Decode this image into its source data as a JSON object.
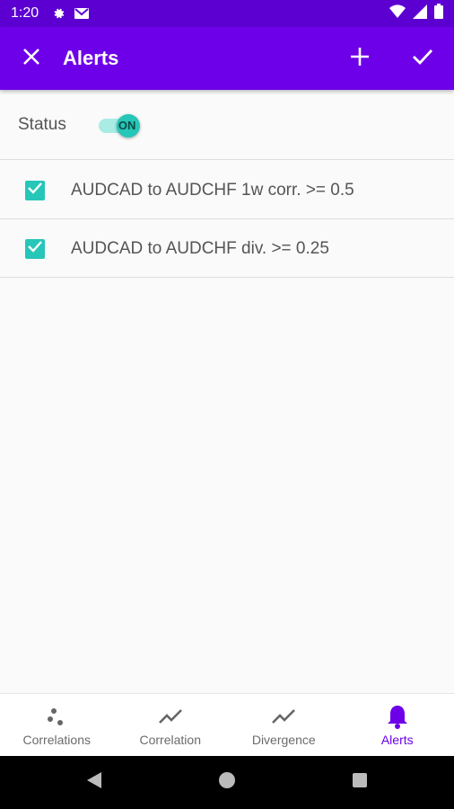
{
  "status_bar": {
    "time": "1:20",
    "icons": [
      "gear-icon",
      "mail-icon",
      "wifi-icon",
      "signal-icon",
      "battery-icon"
    ]
  },
  "app_bar": {
    "title": "Alerts",
    "close_icon": "close-icon",
    "add_icon": "plus-icon",
    "confirm_icon": "check-icon",
    "background": "#6d00e8"
  },
  "status_setting": {
    "label": "Status",
    "toggle_text": "ON",
    "toggle_on": true
  },
  "alerts": [
    {
      "text": "AUDCAD to AUDCHF 1w corr. >= 0.5",
      "checked": true
    },
    {
      "text": "AUDCAD to AUDCHF div. >= 0.25",
      "checked": true
    }
  ],
  "bottom_nav": {
    "items": [
      {
        "label": "Correlations",
        "icon": "dots-icon",
        "active": false
      },
      {
        "label": "Correlation",
        "icon": "trend-line-icon",
        "active": false
      },
      {
        "label": "Divergence",
        "icon": "trend-line-icon",
        "active": false
      },
      {
        "label": "Alerts",
        "icon": "bell-icon",
        "active": true
      }
    ]
  },
  "colors": {
    "accent": "#26c6b8",
    "primary": "#6d00e8",
    "status_bar": "#5c00d2"
  }
}
